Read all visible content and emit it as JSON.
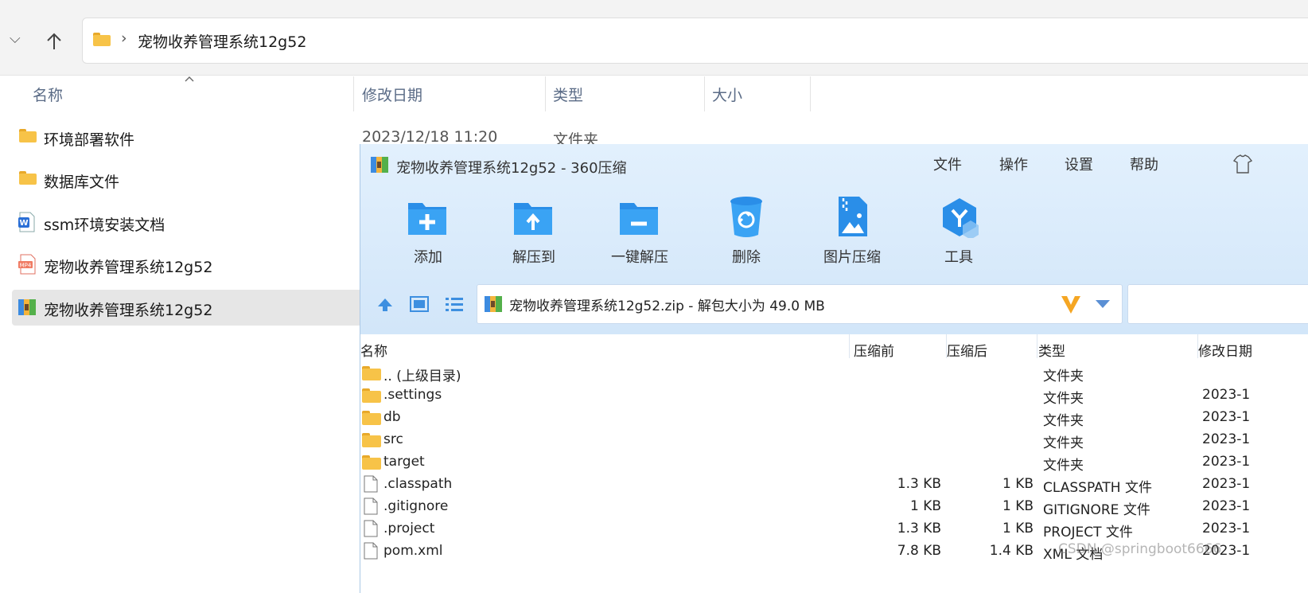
{
  "explorer": {
    "breadcrumb": "宠物收养管理系统12g52",
    "separator": "›",
    "columns": [
      "名称",
      "修改日期",
      "类型",
      "大小"
    ],
    "files": [
      {
        "name": "环境部署软件",
        "date": "2023/12/18 11:20",
        "type": "文件夹",
        "icon": "folder-icon"
      },
      {
        "name": "数据库文件",
        "icon": "folder-icon"
      },
      {
        "name": "ssm环境安装文档",
        "icon": "word-doc-icon"
      },
      {
        "name": "宠物收养管理系统12g52",
        "icon": "mp4-video-icon"
      },
      {
        "name": "宠物收养管理系统12g52",
        "icon": "zip-archive-icon",
        "selected": true
      }
    ]
  },
  "zip": {
    "title": "宠物收养管理系统12g52 - 360压缩",
    "menu": [
      "文件",
      "操作",
      "设置",
      "帮助"
    ],
    "toolbar": [
      {
        "label": "添加",
        "icon": "add-folder-icon"
      },
      {
        "label": "解压到",
        "icon": "extract-to-icon"
      },
      {
        "label": "一键解压",
        "icon": "one-click-extract-icon"
      },
      {
        "label": "删除",
        "icon": "recycle-bin-icon"
      },
      {
        "label": "图片压缩",
        "icon": "image-compress-icon"
      },
      {
        "label": "工具",
        "icon": "tools-icon"
      }
    ],
    "path": "宠物收养管理系统12g52.zip - 解包大小为 49.0 MB",
    "columns": {
      "name": "名称",
      "before": "压缩前",
      "after": "压缩后",
      "type": "类型",
      "modified": "修改日期"
    },
    "rows": [
      {
        "name": ".. (上级目录)",
        "before": "",
        "after": "",
        "type": "文件夹",
        "modified": "",
        "icon": "folder-icon"
      },
      {
        "name": ".settings",
        "before": "",
        "after": "",
        "type": "文件夹",
        "modified": "2023-1",
        "icon": "folder-icon"
      },
      {
        "name": "db",
        "before": "",
        "after": "",
        "type": "文件夹",
        "modified": "2023-1",
        "icon": "folder-icon"
      },
      {
        "name": "src",
        "before": "",
        "after": "",
        "type": "文件夹",
        "modified": "2023-1",
        "icon": "folder-icon"
      },
      {
        "name": "target",
        "before": "",
        "after": "",
        "type": "文件夹",
        "modified": "2023-1",
        "icon": "folder-icon"
      },
      {
        "name": ".classpath",
        "before": "1.3 KB",
        "after": "1 KB",
        "type": "CLASSPATH 文件",
        "modified": "2023-1",
        "icon": "file-icon"
      },
      {
        "name": ".gitignore",
        "before": "1 KB",
        "after": "1 KB",
        "type": "GITIGNORE 文件",
        "modified": "2023-1",
        "icon": "file-icon"
      },
      {
        "name": ".project",
        "before": "1.3 KB",
        "after": "1 KB",
        "type": "PROJECT 文件",
        "modified": "2023-1",
        "icon": "file-icon"
      },
      {
        "name": "pom.xml",
        "before": "7.8 KB",
        "after": "1.4 KB",
        "type": "XML 文档",
        "modified": "2023-1",
        "icon": "file-icon"
      }
    ]
  },
  "watermark": "CSDN @springboot6666",
  "colors": {
    "accent": "#1e88e5",
    "toolbar_bg": "#d8eafb",
    "selection": "#e6e6e6",
    "folder": "#f7c348"
  }
}
